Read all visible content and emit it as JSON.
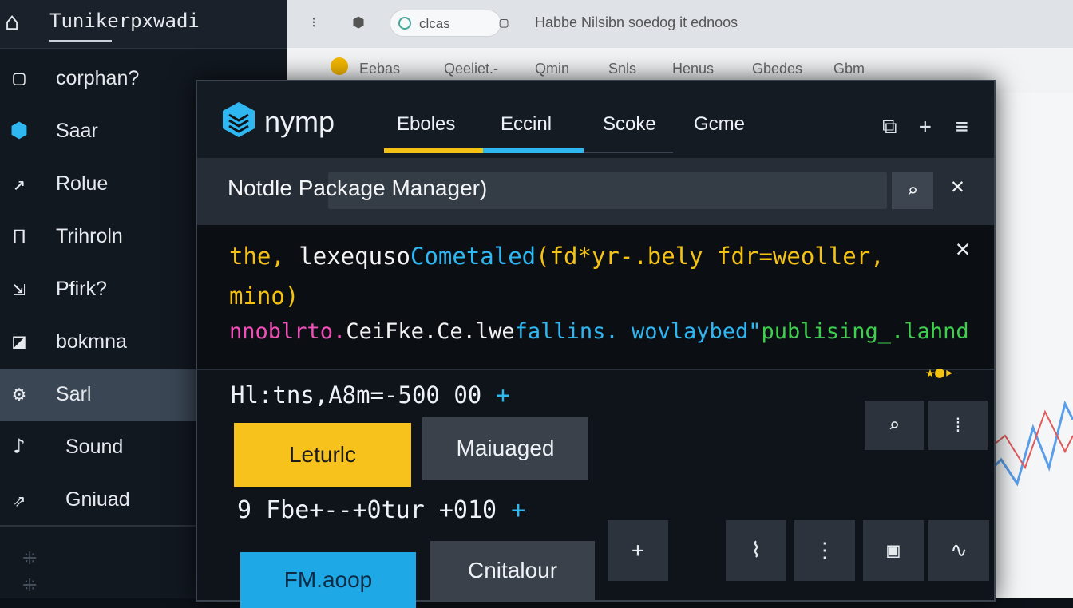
{
  "sidebar": {
    "title": "Tunikerpxwadi",
    "items": [
      {
        "label": "corphan?",
        "icon": "square-icon"
      },
      {
        "label": "Saar",
        "icon": "hexagon-plus-icon"
      },
      {
        "label": "Rolue",
        "icon": "arrow-diagonal-icon"
      },
      {
        "label": "Trihroln",
        "icon": "bracket-icon"
      },
      {
        "label": "Pfirk?",
        "icon": "corner-arrow-icon"
      },
      {
        "label": "bokmna",
        "icon": "checkbox-icon"
      },
      {
        "label": "Sarl",
        "icon": "gear-icon"
      },
      {
        "label": "Sound",
        "icon": "sound-icon"
      },
      {
        "label": "Gniuad",
        "icon": "share-icon"
      }
    ]
  },
  "browser": {
    "address": "clcas",
    "page_title": "Habbe Nilsibn soedog it ednoos",
    "bookmarks": [
      "Eebas",
      "Qeeliet.-",
      "Qmin",
      "Snls",
      "Henus",
      "Gbedes",
      "Gbm"
    ]
  },
  "app": {
    "brand": "nymp",
    "tabs": [
      {
        "label": "Eboles",
        "accent": "#f3c214"
      },
      {
        "label": "Eccinl",
        "accent": "#2fb7f2"
      },
      {
        "label": "Scoke",
        "accent": ""
      },
      {
        "label": "Gcme",
        "accent": ""
      }
    ],
    "search_label": "Notdle Package Manager)",
    "code_lines": {
      "line1": {
        "a": "the,",
        "b": " lexequso",
        "c": "Cometaled",
        "d": "(fd*yr-.bely",
        "e": " fdr=weoller,"
      },
      "line2": {
        "a": "mino)"
      },
      "line3": {
        "a": "nnoblrto.",
        "b": "CeiFke.Ce.lwe",
        "c": "fallins. wovlaybed\"",
        "d": "publising_.lahnd"
      }
    },
    "stats": {
      "text": "Hl:tns,A8m=-500 00",
      "plus": "+"
    },
    "primary_button": "Leturlc",
    "secondary_button": "Maiuaged",
    "version": {
      "text": "9  Fbe+--+0tur +010",
      "plus": "+"
    },
    "footer_primary_button": "FM.aoop",
    "footer_secondary_button": "Cnitalour",
    "colors": {
      "yellow": "#f7c21c",
      "blue": "#1ea8e6",
      "pink": "#f04fb8",
      "green": "#3fcf4e"
    }
  }
}
